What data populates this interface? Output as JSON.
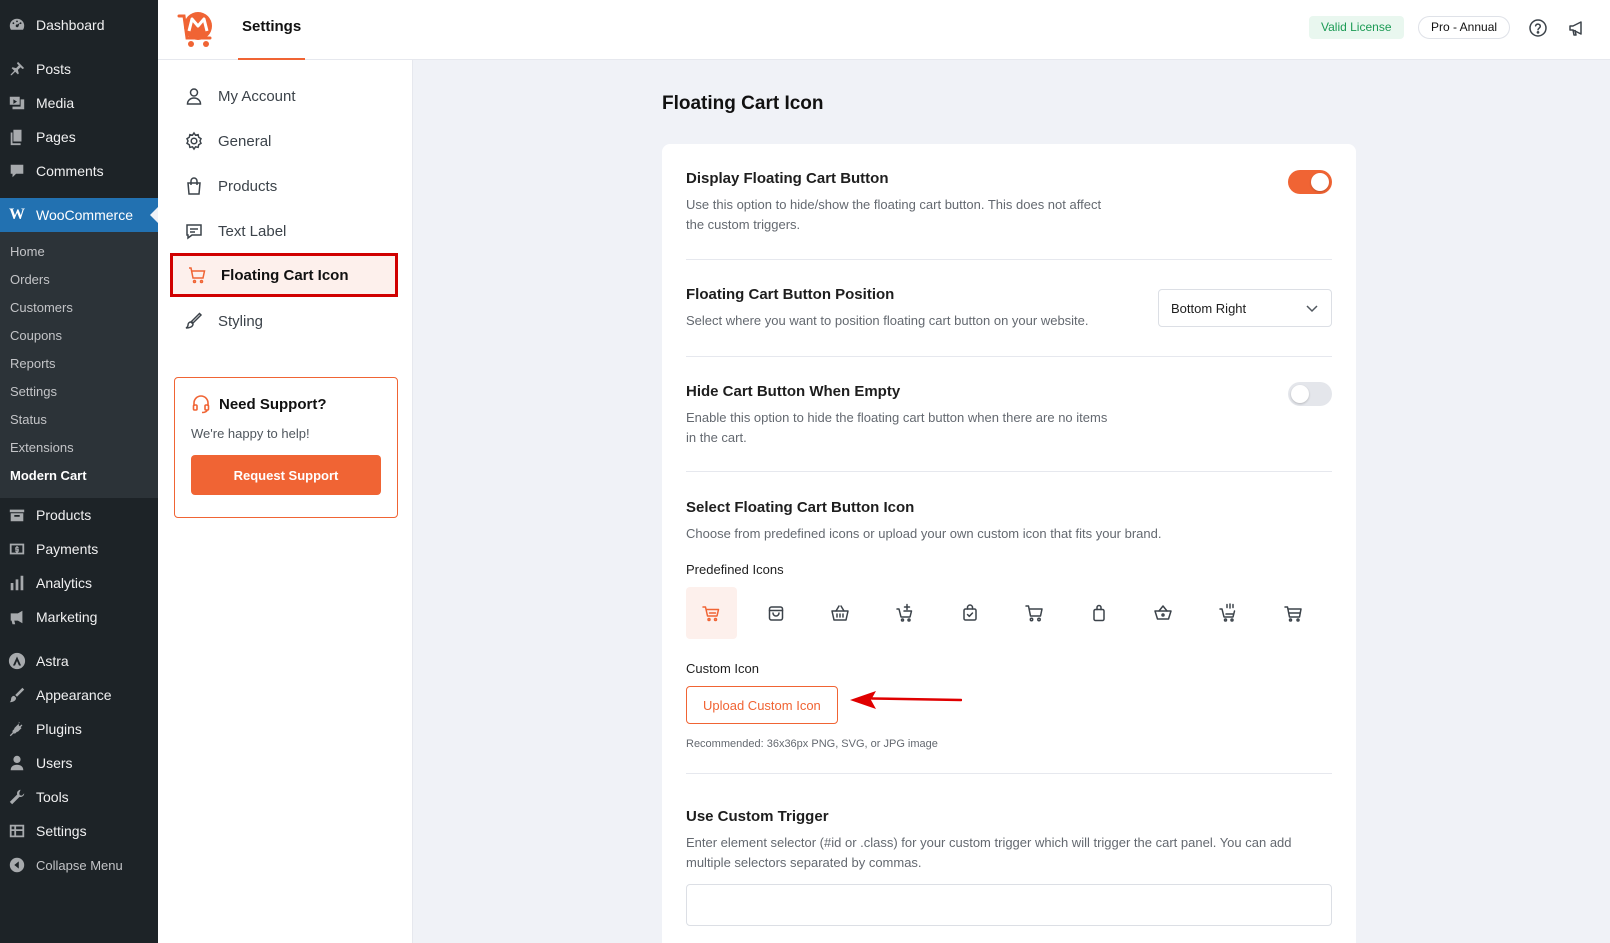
{
  "wp_menu": {
    "dashboard": "Dashboard",
    "posts": "Posts",
    "media": "Media",
    "pages": "Pages",
    "comments": "Comments",
    "woocommerce": "WooCommerce",
    "woo_submenu": [
      "Home",
      "Orders",
      "Customers",
      "Coupons",
      "Reports",
      "Settings",
      "Status",
      "Extensions",
      "Modern Cart"
    ],
    "products": "Products",
    "payments": "Payments",
    "analytics": "Analytics",
    "marketing": "Marketing",
    "astra": "Astra",
    "appearance": "Appearance",
    "plugins": "Plugins",
    "users": "Users",
    "tools": "Tools",
    "settings": "Settings",
    "collapse": "Collapse Menu"
  },
  "topbar": {
    "title": "Settings",
    "license": "Valid License",
    "plan": "Pro - Annual"
  },
  "nav": {
    "items": [
      "My Account",
      "General",
      "Products",
      "Text Label",
      "Floating Cart Icon",
      "Styling"
    ],
    "active_index": 4
  },
  "support": {
    "title": "Need Support?",
    "subtitle": "We're happy to help!",
    "button": "Request Support"
  },
  "main": {
    "title": "Floating Cart Icon",
    "display": {
      "title": "Display Floating Cart Button",
      "desc": "Use this option to hide/show the floating cart button. This does not affect the custom triggers.",
      "enabled": true
    },
    "position": {
      "title": "Floating Cart Button Position",
      "desc": "Select where you want to position floating cart button on your website.",
      "value": "Bottom Right"
    },
    "hide_empty": {
      "title": "Hide Cart Button When Empty",
      "desc": "Enable this option to hide the floating cart button when there are no items in the cart.",
      "enabled": false
    },
    "icon": {
      "title": "Select Floating Cart Button Icon",
      "desc": "Choose from predefined icons or upload your own custom icon that fits your brand.",
      "predefined_label": "Predefined Icons",
      "icons": [
        "cart-icon",
        "shopping-bag-icon",
        "basket-icon",
        "cart-plus-icon",
        "bag-check-icon",
        "cart-alt-icon",
        "bag-icon",
        "basket-alt-icon",
        "cart-add-icon",
        "cart-flat-icon"
      ],
      "selected_index": 0,
      "custom_label": "Custom Icon",
      "upload_button": "Upload Custom Icon",
      "hint": "Recommended: 36x36px PNG, SVG, or JPG image"
    },
    "trigger": {
      "title": "Use Custom Trigger",
      "desc": "Enter element selector (#id or .class) for your custom trigger which will trigger the cart panel. You can add multiple selectors separated by commas.",
      "value": ""
    }
  },
  "colors": {
    "accent": "#f06434",
    "wp_sidebar": "#1d2327",
    "wp_active": "#2271b1",
    "highlight_border": "#d00000",
    "license_green": "#1c9b55"
  }
}
